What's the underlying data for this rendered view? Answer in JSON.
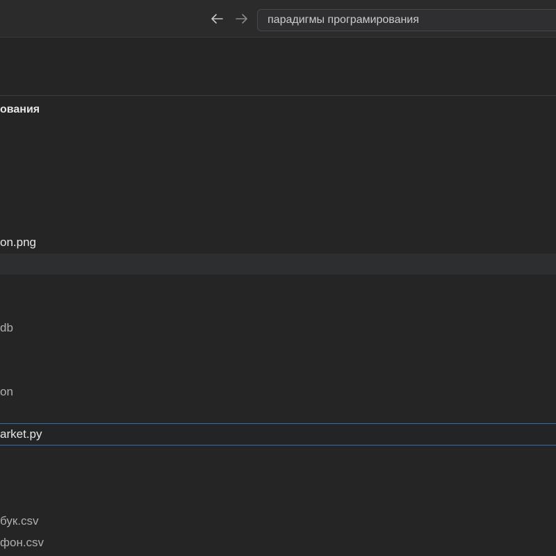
{
  "titlebar": {
    "search_text": "парадигмы програмирования"
  },
  "icons": {
    "back": "arrow-left-icon",
    "forward": "arrow-right-icon"
  },
  "explorer": {
    "folder_title": "ования",
    "items": {
      "png_file": "on.png",
      "db_file": "db",
      "json_file": "on",
      "py_file": "arket.py",
      "csv_file_1": "бук.csv",
      "csv_file_2": "фон.csv"
    }
  }
}
